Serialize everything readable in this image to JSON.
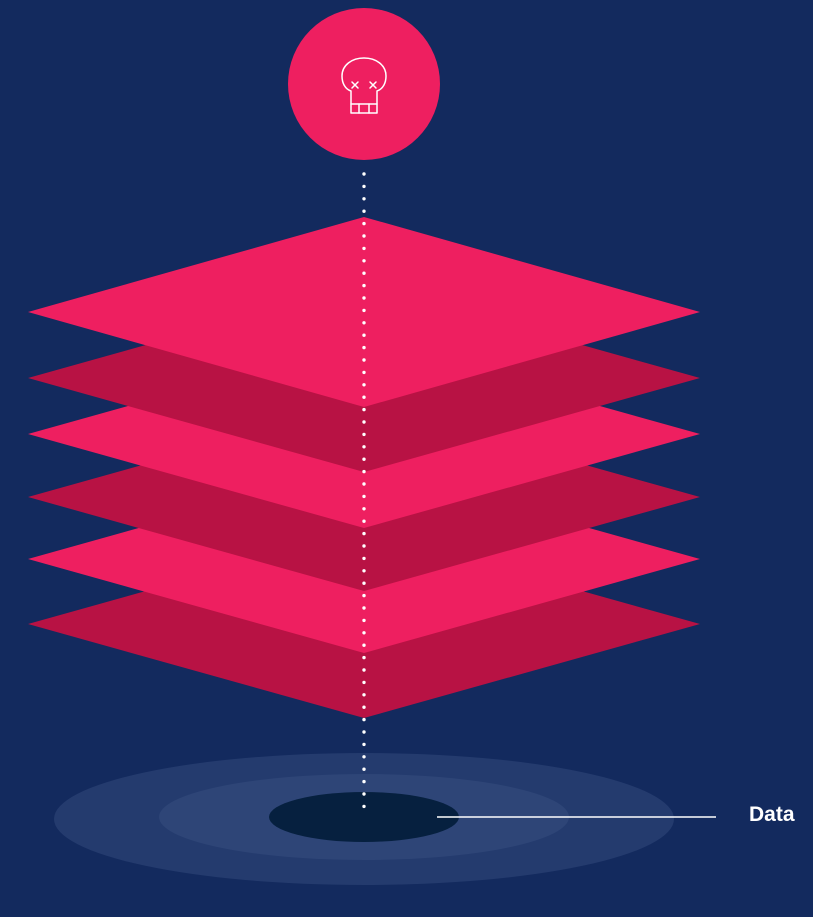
{
  "diagram": {
    "label": "Data",
    "icon": "skull-icon",
    "layer_count": 6,
    "colors": {
      "background": "#132a5e",
      "layer_light": "#ee1f60",
      "layer_dark": "#b81244",
      "skull_circle": "#ee1f60",
      "data_hole": "#06203f",
      "ring_outer": "#253d6f",
      "ring_inner": "#2f4778",
      "connector": "#ffffff"
    }
  }
}
